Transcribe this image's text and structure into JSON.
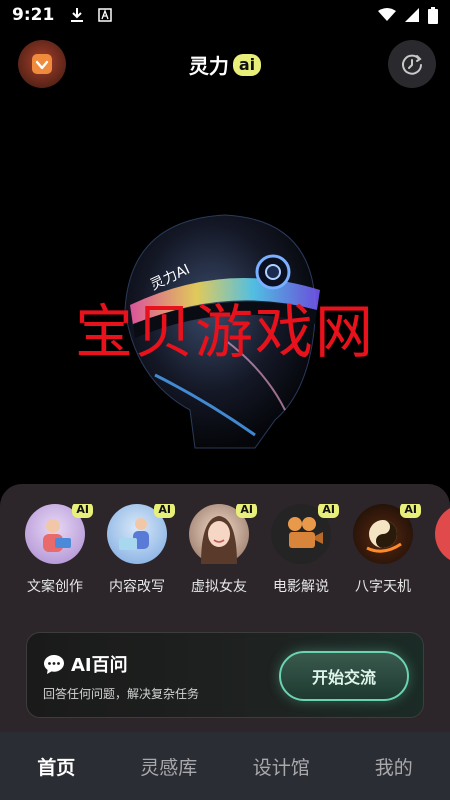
{
  "status_bar": {
    "time": "9:21"
  },
  "header": {
    "title": "灵力",
    "badge": "ai"
  },
  "hero": {
    "helmet_text": "灵力AI",
    "watermark": "宝贝游戏网"
  },
  "tools": [
    {
      "label": "文案创作",
      "badge": "AI",
      "color": "#b79ad8"
    },
    {
      "label": "内容改写",
      "badge": "AI",
      "color": "#8fb8e8"
    },
    {
      "label": "虚拟女友",
      "badge": "AI",
      "color": "#d9b8a8"
    },
    {
      "label": "电影解说",
      "badge": "AI",
      "color": "#2a2a2a"
    },
    {
      "label": "八字天机",
      "badge": "AI",
      "color": "#1a1208"
    }
  ],
  "qa_card": {
    "title": "AI百问",
    "subtitle": "回答任何问题，解决复杂任务",
    "button": "开始交流"
  },
  "nav": [
    {
      "label": "首页",
      "active": true
    },
    {
      "label": "灵感库",
      "active": false
    },
    {
      "label": "设计馆",
      "active": false
    },
    {
      "label": "我的",
      "active": false
    }
  ],
  "colors": {
    "accent_yellow": "#e8f07a",
    "accent_teal": "#6bd3b0",
    "watermark_red": "#e8121c"
  }
}
